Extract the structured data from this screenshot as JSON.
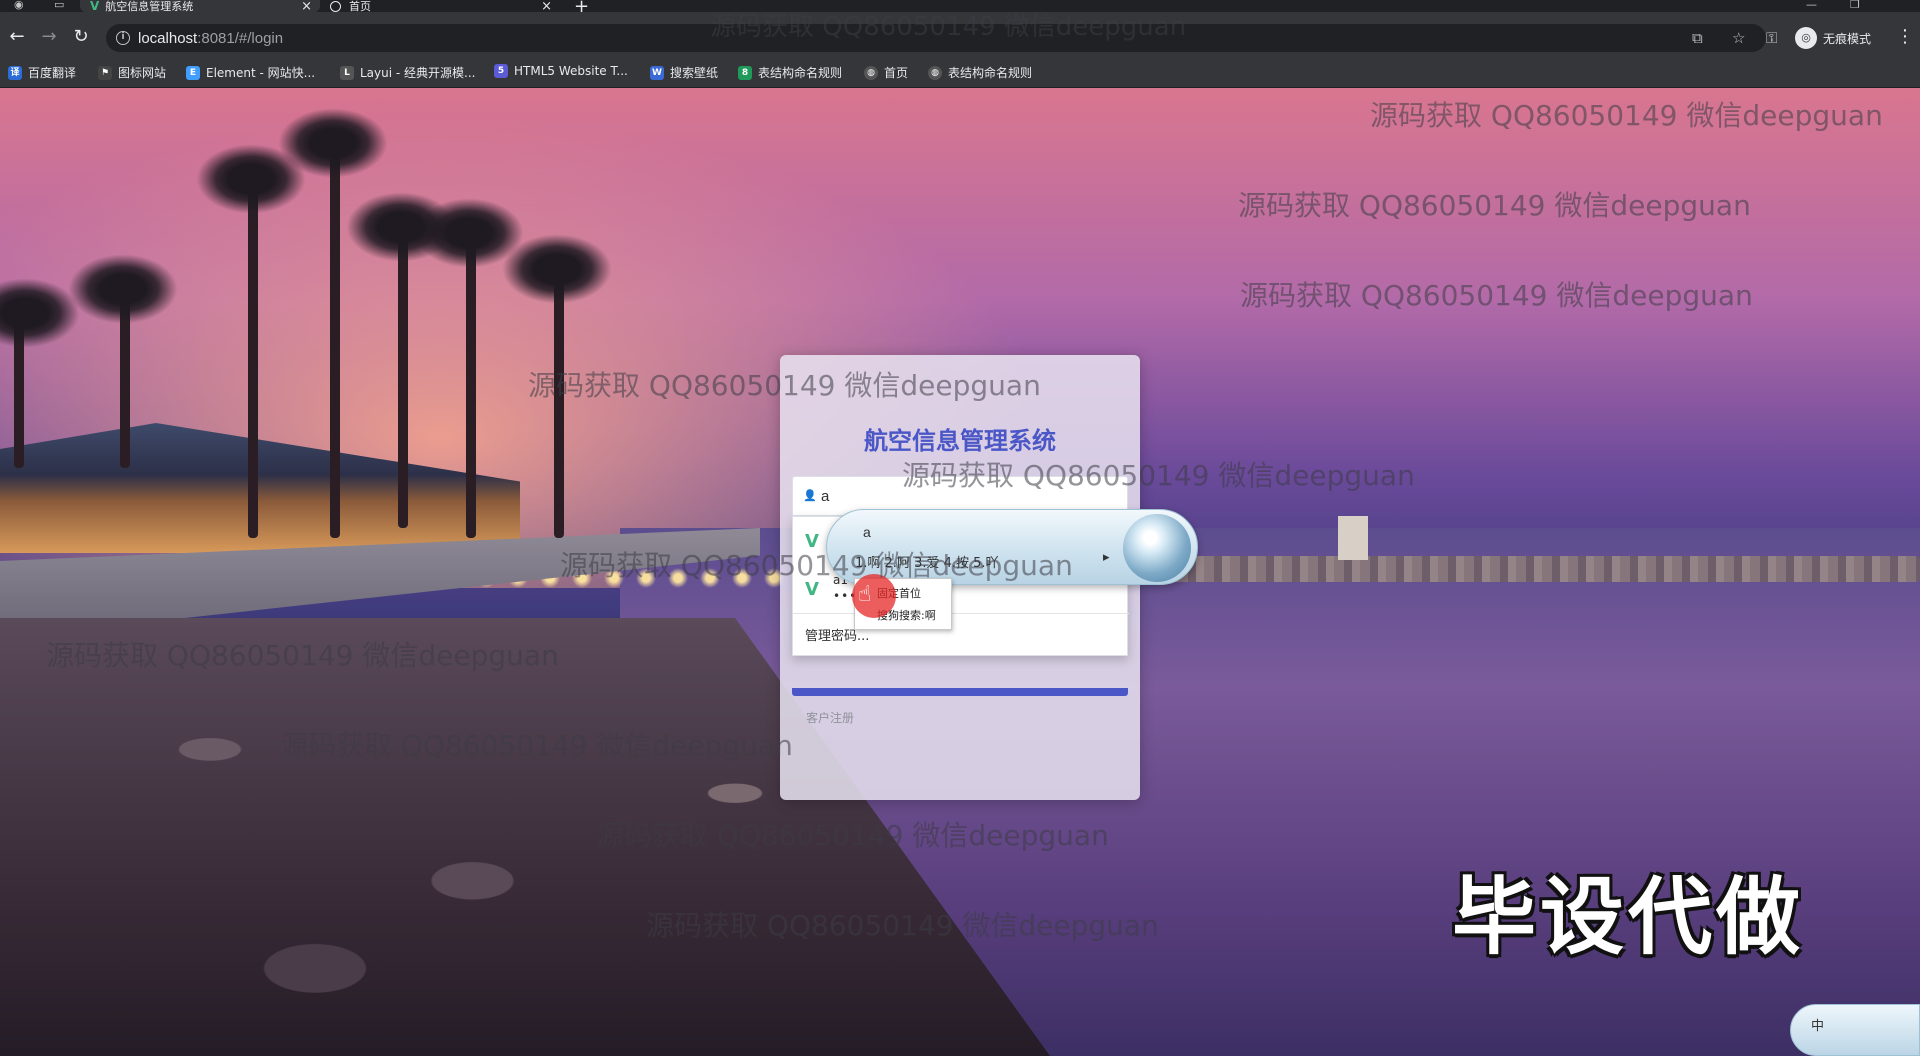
{
  "browser": {
    "tabs": [
      {
        "title": "航空信息管理系统",
        "active": true
      },
      {
        "title": "首页",
        "active": false
      }
    ],
    "url_host": "localhost",
    "url_rest": ":8081/#/login",
    "profile_label": "无痕模式",
    "bookmarks": [
      {
        "label": "百度翻译",
        "icon": "baidu-translate-icon",
        "color": "#2b6cd6"
      },
      {
        "label": "图标网站",
        "icon": "flag-icon",
        "color": "#444444"
      },
      {
        "label": "Element - 网站快...",
        "icon": "element-icon",
        "color": "#409eff"
      },
      {
        "label": "Layui - 经典开源模...",
        "icon": "layui-icon",
        "color": "#555555"
      },
      {
        "label": "HTML5 Website T...",
        "icon": "html5-icon",
        "color": "#5b5bd6"
      },
      {
        "label": "搜索壁纸",
        "icon": "wallpaper-icon",
        "color": "#3a6ad6"
      },
      {
        "label": "表结构命名规则",
        "icon": "table-icon",
        "color": "#1f9a5a"
      },
      {
        "label": "首页",
        "icon": "globe-icon",
        "color": "#555555"
      },
      {
        "label": "表结构命名规则",
        "icon": "globe-icon",
        "color": "#555555"
      }
    ]
  },
  "login": {
    "title": "航空信息管理系统",
    "username_value": "a",
    "autofill": {
      "entries": [
        {
          "user": "a1",
          "password": "••••"
        }
      ],
      "manage_label": "管理密码..."
    },
    "register_label": "客户注册"
  },
  "ime": {
    "composition": "a",
    "candidates": "1.啊  2.阿  3.爱  4.按  5.吖",
    "menu_items": [
      "固定首位",
      "搜狗搜索:啊"
    ],
    "tray_label": "中"
  },
  "overlay": {
    "watermark": "源码获取 QQ86050149 微信deepguan",
    "promo": "毕设代做"
  },
  "colors": {
    "title_blue": "#4b57c7",
    "vue_green": "#41b883"
  }
}
